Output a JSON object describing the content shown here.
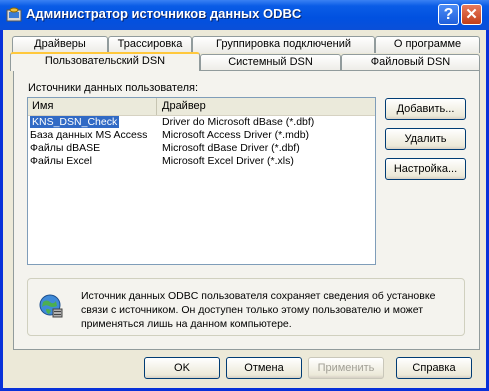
{
  "window": {
    "title": "Администратор источников данных ODBC",
    "help_button": "?",
    "close_button": "✕"
  },
  "tabs_back": [
    "Драйверы",
    "Трассировка",
    "Группировка подключений",
    "О программе"
  ],
  "tabs_front": [
    "Пользовательский DSN",
    "Системный DSN",
    "Файловый DSN"
  ],
  "active_tab": "Пользовательский DSN",
  "list": {
    "label": "Источники данных пользователя:",
    "columns": [
      "Имя",
      "Драйвер"
    ],
    "rows": [
      {
        "name": "KNS_DSN_Check",
        "driver": "Driver do Microsoft dBase (*.dbf)",
        "selected": true
      },
      {
        "name": "База данных MS Access",
        "driver": "Microsoft Access Driver (*.mdb)",
        "selected": false
      },
      {
        "name": "Файлы dBASE",
        "driver": "Microsoft dBase Driver (*.dbf)",
        "selected": false
      },
      {
        "name": "Файлы Excel",
        "driver": "Microsoft Excel Driver (*.xls)",
        "selected": false
      }
    ]
  },
  "side_buttons": {
    "add": "Добавить...",
    "remove": "Удалить",
    "configure": "Настройка..."
  },
  "info_text": "Источник данных ODBC пользователя сохраняет сведения об установке связи с источником. Он доступен только этому пользователю и может применяться лишь на данном компьютере.",
  "bottom_buttons": {
    "ok": "OK",
    "cancel": "Отмена",
    "apply": "Применить",
    "help": "Справка"
  },
  "colors": {
    "titlebar": "#0a5ce6",
    "selection": "#316ac5",
    "active_tab_accent": "#ffc83c"
  }
}
